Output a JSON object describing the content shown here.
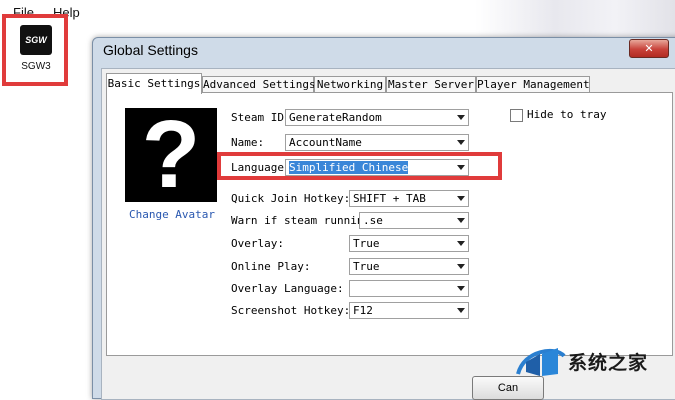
{
  "menubar": {
    "file": "File",
    "help": "Help"
  },
  "desktop_icon": {
    "icon_text": "SGW",
    "label": "SGW3"
  },
  "window": {
    "title": "Global Settings",
    "close_glyph": "✕"
  },
  "tabs": [
    {
      "label": "Basic Settings",
      "active": true
    },
    {
      "label": "Advanced Settings",
      "active": false
    },
    {
      "label": "Networking",
      "active": false
    },
    {
      "label": "Master Server",
      "active": false
    },
    {
      "label": "Player Management",
      "active": false
    }
  ],
  "avatar": {
    "glyph": "?",
    "link": "Change Avatar"
  },
  "fields": {
    "steam_id": {
      "label": "Steam ID:",
      "value": "GenerateRandom"
    },
    "name": {
      "label": "Name:",
      "value": "AccountName"
    },
    "language": {
      "label": "Language:",
      "value": "Simplified Chinese"
    },
    "quick_join_hotkey": {
      "label": "Quick Join Hotkey:",
      "value": "SHIFT + TAB"
    },
    "warn_steam_running": {
      "label": "Warn if steam running:",
      "value": ".se"
    },
    "overlay": {
      "label": "Overlay:",
      "value": "True"
    },
    "online_play": {
      "label": "Online Play:",
      "value": "True"
    },
    "overlay_language": {
      "label": "Overlay Language:",
      "value": ""
    },
    "screenshot_hotkey": {
      "label": "Screenshot Hotkey:",
      "value": "F12"
    }
  },
  "hide_to_tray": {
    "label": "Hide to tray",
    "checked": false
  },
  "buttons": {
    "cancel": "Can"
  },
  "watermark": {
    "text": "系统之家"
  },
  "colors": {
    "highlight_red": "#e03b3b",
    "selection_blue": "#3a86d8",
    "link_blue": "#2a58b0"
  }
}
